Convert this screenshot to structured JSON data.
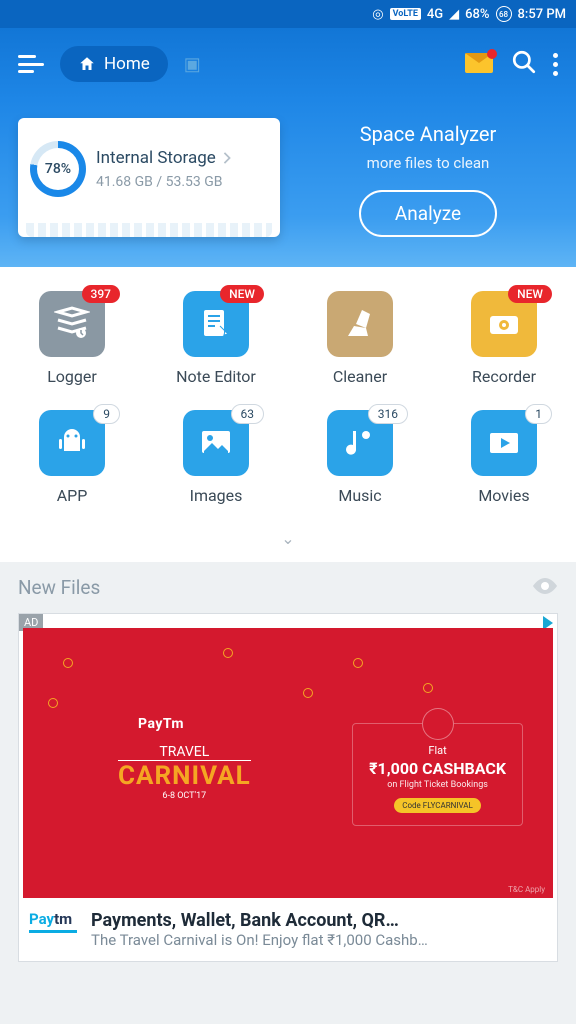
{
  "status": {
    "volte": "VoLTE",
    "net": "4G",
    "battery": "68%",
    "time": "8:57 PM",
    "badge": "68"
  },
  "header": {
    "home": "Home"
  },
  "storage": {
    "percent": "78%",
    "title": "Internal Storage",
    "used_total": "41.68 GB / 53.53 GB"
  },
  "analyzer": {
    "title": "Space Analyzer",
    "subtitle": "more files to clean",
    "button": "Analyze"
  },
  "tools": [
    {
      "label": "Logger",
      "badge": "397",
      "badge_type": "red",
      "color": "#8a98a3",
      "icon": "stack"
    },
    {
      "label": "Note Editor",
      "badge": "NEW",
      "badge_type": "red",
      "color": "#2ba3e8",
      "icon": "note"
    },
    {
      "label": "Cleaner",
      "badge": "",
      "badge_type": "",
      "color": "#c9a873",
      "icon": "broom"
    },
    {
      "label": "Recorder",
      "badge": "NEW",
      "badge_type": "red",
      "color": "#f0b93b",
      "icon": "camera"
    }
  ],
  "cats": [
    {
      "label": "APP",
      "badge": "9",
      "color": "#2ba3e8",
      "icon": "android"
    },
    {
      "label": "Images",
      "badge": "63",
      "color": "#2ba3e8",
      "icon": "image"
    },
    {
      "label": "Music",
      "badge": "316",
      "color": "#2ba3e8",
      "icon": "music"
    },
    {
      "label": "Movies",
      "badge": "1",
      "color": "#2ba3e8",
      "icon": "video"
    }
  ],
  "section": {
    "new_files": "New Files"
  },
  "ad": {
    "tag": "AD",
    "brand": "PayTm",
    "carnival_top": "TRAVEL",
    "carnival_main": "CARNIVAL",
    "carnival_date": "6-8 OCT'17",
    "cash_flat": "Flat",
    "cash_amount": "₹1,000 CASHBACK",
    "cash_sub": "on Flight Ticket Bookings",
    "cash_code": "Code FLYCARNIVAL",
    "tc": "T&C Apply",
    "footer_logo1": "Pay",
    "footer_logo2": "tm",
    "footer_head": "Payments, Wallet, Bank Account, QR…",
    "footer_sub": "The Travel Carnival is On! Enjoy flat ₹1,000 Cashb…"
  }
}
